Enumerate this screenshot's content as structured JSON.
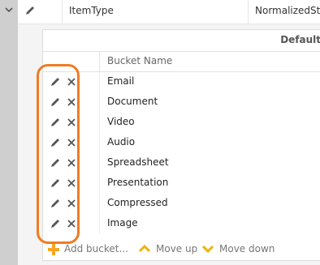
{
  "top_row": {
    "name": "ItemType",
    "type": "NormalizedString"
  },
  "panel": {
    "title": "Default",
    "column_header": "Bucket Name",
    "buckets": [
      {
        "label": "Email"
      },
      {
        "label": "Document"
      },
      {
        "label": "Video"
      },
      {
        "label": "Audio"
      },
      {
        "label": "Spreadsheet"
      },
      {
        "label": "Presentation"
      },
      {
        "label": "Compressed"
      },
      {
        "label": "Image"
      }
    ]
  },
  "footer": {
    "add_label": "Add bucket...",
    "move_up_label": "Move up",
    "move_down_label": "Move down"
  },
  "colors": {
    "highlight": "#f07c22",
    "add_icon": "#f5a623",
    "arrow_icon": "#f0b400"
  }
}
